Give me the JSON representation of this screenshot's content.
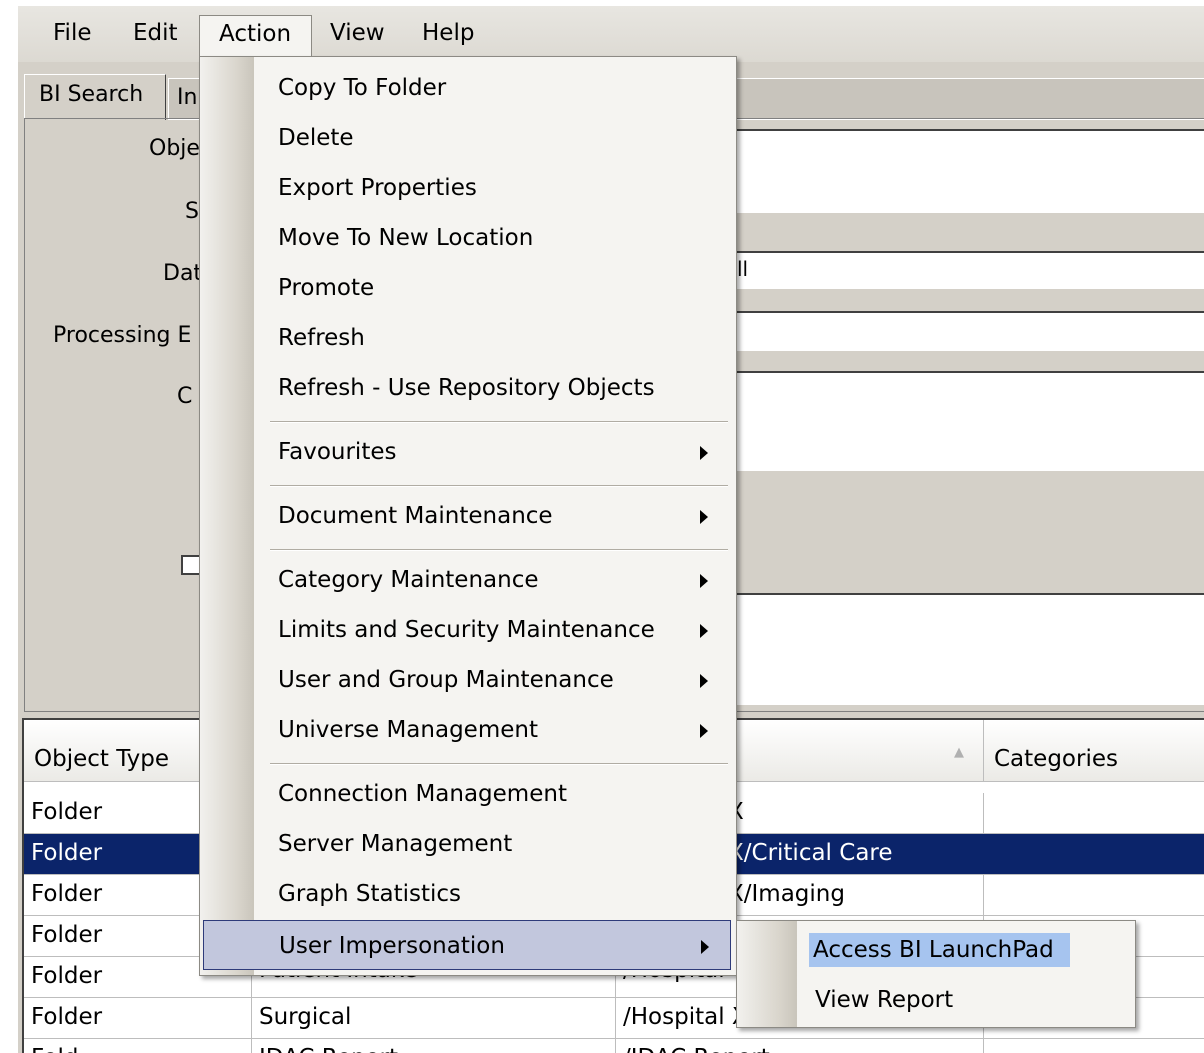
{
  "menubar": [
    "File",
    "Edit",
    "Action",
    "View",
    "Help"
  ],
  "tabs": {
    "active": "BI Search",
    "inactive": "In"
  },
  "form": {
    "labels": [
      "Obje",
      "S",
      "Dat",
      "Processing E",
      "C"
    ],
    "inputs": [
      "",
      "",
      "ll",
      "",
      ""
    ]
  },
  "table": {
    "headers": [
      "Object Type",
      "",
      "",
      "Categories"
    ],
    "rows": [
      [
        "Folder",
        "",
        "X",
        ""
      ],
      [
        "Folder",
        "",
        "X/Critical Care",
        ""
      ],
      [
        "Folder",
        "",
        "X/Imaging",
        ""
      ],
      [
        "Folder",
        "",
        "",
        ""
      ],
      [
        "Folder",
        "Patient Intake",
        "/Hospital",
        ""
      ],
      [
        "Folder",
        "Surgical",
        "/Hospital X",
        ""
      ],
      [
        "Fold",
        "IDAC Report",
        "/IDAC Report",
        ""
      ]
    ],
    "selected_row": 1,
    "sort_indicator": "▲"
  },
  "action_menu": {
    "items": [
      {
        "label": "Copy To Folder"
      },
      {
        "label": "Delete"
      },
      {
        "label": "Export Properties"
      },
      {
        "label": "Move To New Location"
      },
      {
        "label": "Promote"
      },
      {
        "label": "Refresh"
      },
      {
        "label": "Refresh - Use Repository Objects"
      },
      {
        "label": "Favourites",
        "submenu": true
      },
      {
        "label": "Document Maintenance",
        "submenu": true
      },
      {
        "label": "Category Maintenance",
        "submenu": true
      },
      {
        "label": "Limits and Security Maintenance",
        "submenu": true
      },
      {
        "label": "User and Group Maintenance",
        "submenu": true
      },
      {
        "label": "Universe Management",
        "submenu": true
      },
      {
        "label": "Connection Management"
      },
      {
        "label": "Server Management"
      },
      {
        "label": "Graph Statistics"
      },
      {
        "label": "User Impersonation",
        "submenu": true,
        "highlighted": true
      }
    ]
  },
  "submenu": {
    "items": [
      {
        "label": "Access BI LaunchPad",
        "highlighted": true
      },
      {
        "label": "View Report"
      }
    ]
  },
  "colors": {
    "selection": "#0b246a",
    "menu_highlight": "#c2c7dd",
    "submenu_highlight": "#a6c4ef"
  }
}
